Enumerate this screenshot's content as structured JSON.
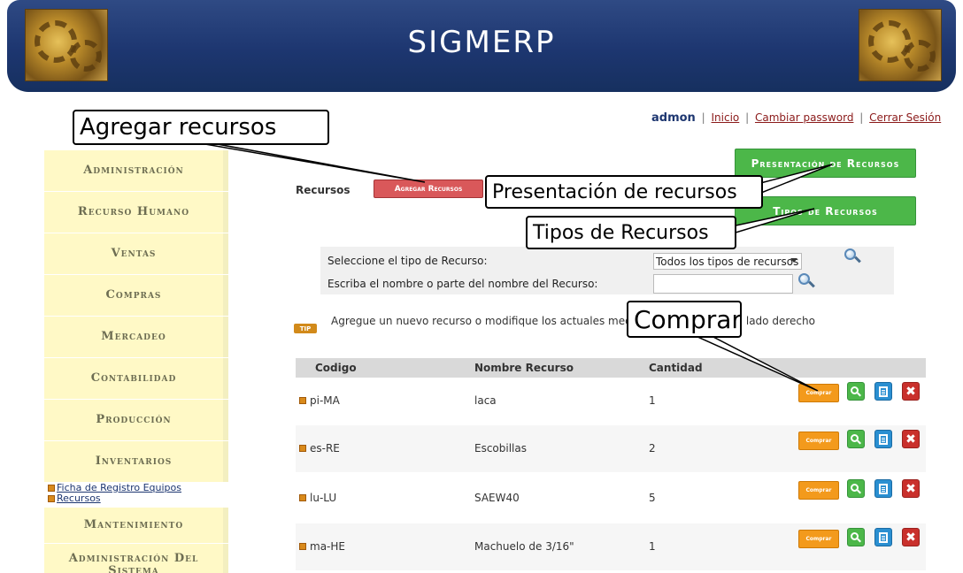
{
  "header": {
    "title": "SIGMERP",
    "left_logo_icon": "gears-icon",
    "right_logo_icon": "gears-icon"
  },
  "user_bar": {
    "username": "admon",
    "links": [
      "Inicio",
      "Cambiar password",
      "Cerrar Sesión"
    ],
    "separator": "|"
  },
  "sidebar": {
    "items": [
      {
        "label": "Administración"
      },
      {
        "label": "Recurso Humano"
      },
      {
        "label": "Ventas"
      },
      {
        "label": "Compras"
      },
      {
        "label": "Mercadeo"
      },
      {
        "label": "Contabilidad"
      },
      {
        "label": "Producción"
      },
      {
        "label": "Inventarios"
      },
      {
        "label": "Mantenimiento"
      },
      {
        "label": "Administración Del Sistema"
      }
    ],
    "inventarios_subitems": [
      "Ficha de Registro Equipos",
      "Recursos"
    ]
  },
  "toolbar": {
    "section_label": "Recursos",
    "add_button": "Agregar Recursos",
    "presentation_button": "Presentación de Recursos",
    "types_button": "Tipos de Recursos"
  },
  "filter": {
    "type_label": "Seleccione el tipo de Recurso:",
    "type_selected": "Todos los tipos de recursos",
    "name_label": "Escriba el nombre o parte del nombre del Recurso:",
    "name_value": ""
  },
  "tip": {
    "badge": "TIP",
    "text": "Agregue un nuevo recurso o modifique los actuales mediante los botones del lado derecho"
  },
  "table": {
    "columns": [
      "Codigo",
      "Nombre Recurso",
      "Cantidad"
    ],
    "buy_label": "Comprar",
    "rows": [
      {
        "code": "pi-MA",
        "name": "laca",
        "qty": "1"
      },
      {
        "code": "es-RE",
        "name": "Escobillas",
        "qty": "2"
      },
      {
        "code": "lu-LU",
        "name": "SAEW40",
        "qty": "5"
      },
      {
        "code": "ma-HE",
        "name": "Machuelo de 3/16\"",
        "qty": "1"
      }
    ]
  },
  "annotations": {
    "agregar": "Agregar recursos",
    "presentacion": "Presentación de recursos",
    "tipos": "Tipos de Recursos",
    "comprar": "Comprar"
  },
  "colors": {
    "header_bg": "#1d3670",
    "sidebar_bg": "#fff9c6",
    "add_button": "#d9585a",
    "green_button": "#4cb749",
    "buy_button": "#f39a1c",
    "delete_button": "#c9302c",
    "doc_button": "#2a8fd1"
  }
}
